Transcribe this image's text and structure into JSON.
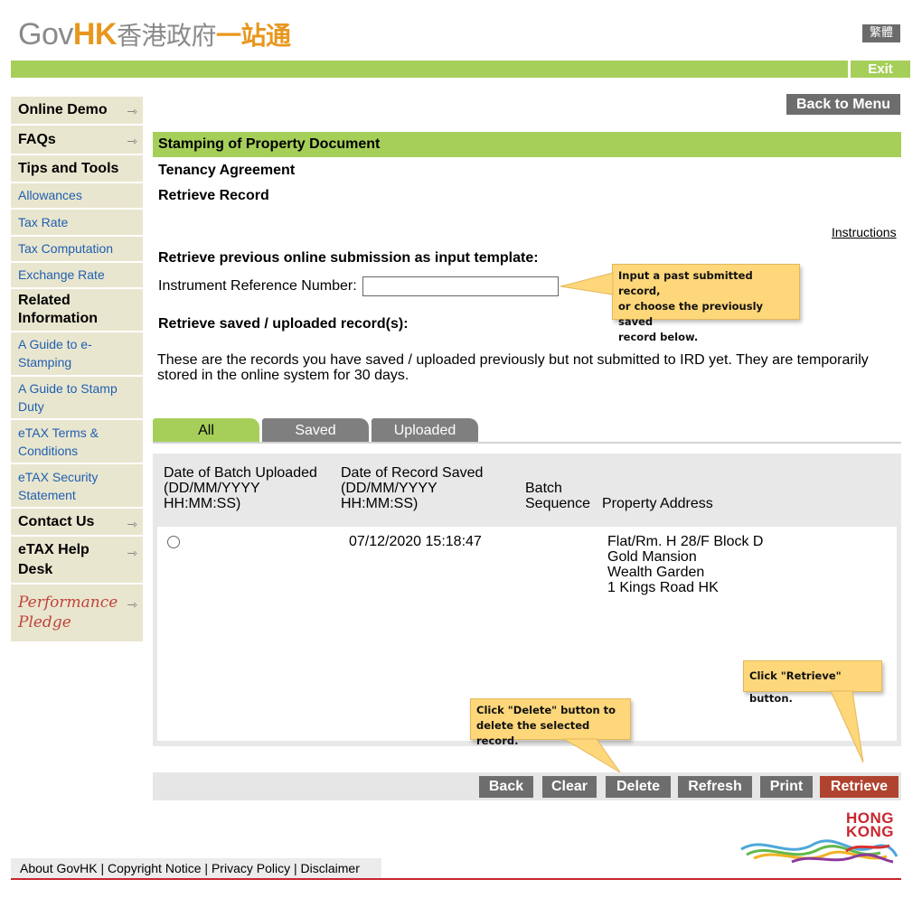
{
  "header": {
    "logo_gov": "Gov",
    "logo_hk": "HK",
    "logo_zh_gov": "香港政府",
    "logo_zh_one": "一站通",
    "lang_toggle": "繁體",
    "exit": "Exit"
  },
  "sidebar": {
    "items": [
      {
        "label": "Online Demo"
      },
      {
        "label": "FAQs"
      },
      {
        "label": "Tips and Tools"
      },
      {
        "label": "Allowances"
      },
      {
        "label": "Tax Rate"
      },
      {
        "label": "Tax Computation"
      },
      {
        "label": "Exchange Rate"
      },
      {
        "label": "Related Information"
      },
      {
        "label": "A Guide to e-Stamping"
      },
      {
        "label": "A Guide to Stamp Duty"
      },
      {
        "label": "eTAX Terms & Conditions"
      },
      {
        "label": "eTAX Security Statement"
      },
      {
        "label": "Contact Us"
      },
      {
        "label": "eTAX Help Desk"
      }
    ],
    "performance_line1": "Performance",
    "performance_line2": "Pledge"
  },
  "main": {
    "back_to_menu": "Back to Menu",
    "section_title": "Stamping of Property Document",
    "subtitle1": "Tenancy Agreement",
    "subtitle2": "Retrieve Record",
    "instructions": "Instructions",
    "retrieve_prev_heading": "Retrieve previous online submission as input template:",
    "ref_label": "Instrument Reference Number:",
    "ref_value": "",
    "saved_heading": "Retrieve saved / uploaded record(s):",
    "description": "These are the records you have saved / uploaded previously but not submitted to IRD yet. They are temporarily stored in the online system for 30 days."
  },
  "tabs": [
    "All",
    "Saved",
    "Uploaded"
  ],
  "table": {
    "headers": {
      "batch_uploaded": [
        "Date of Batch Uploaded",
        "(DD/MM/YYYY",
        "HH:MM:SS)"
      ],
      "record_saved": [
        "Date of Record Saved",
        "(DD/MM/YYYY",
        "HH:MM:SS)"
      ],
      "batch_sequence": [
        "Batch",
        "Sequence"
      ],
      "property_address": "Property Address"
    },
    "rows": [
      {
        "record_saved": "07/12/2020 15:18:47",
        "address": [
          "Flat/Rm. H 28/F Block D",
          "Gold Mansion",
          "Wealth Garden",
          "1 Kings Road HK"
        ]
      }
    ]
  },
  "callouts": {
    "input": [
      "Input a past submitted record,",
      "or choose the previously saved",
      "record below."
    ],
    "retrieve": "Click \"Retrieve\" button.",
    "delete": [
      "Click \"Delete\" button to",
      "delete the selected record."
    ]
  },
  "buttons": {
    "back": "Back",
    "clear": "Clear",
    "delete": "Delete",
    "refresh": "Refresh",
    "print": "Print",
    "retrieve": "Retrieve"
  },
  "hk_logo": [
    "HONG",
    "KONG"
  ],
  "footer": {
    "about": "About GovHK",
    "copyright": "Copyright Notice",
    "privacy": "Privacy Policy",
    "disclaimer": "Disclaimer",
    "separator": "|"
  },
  "colors": {
    "accent_green": "#a6cf5a",
    "brand_orange": "#e8971e",
    "retrieve_red": "#b0432f",
    "button_gray": "#6d6d6d"
  }
}
